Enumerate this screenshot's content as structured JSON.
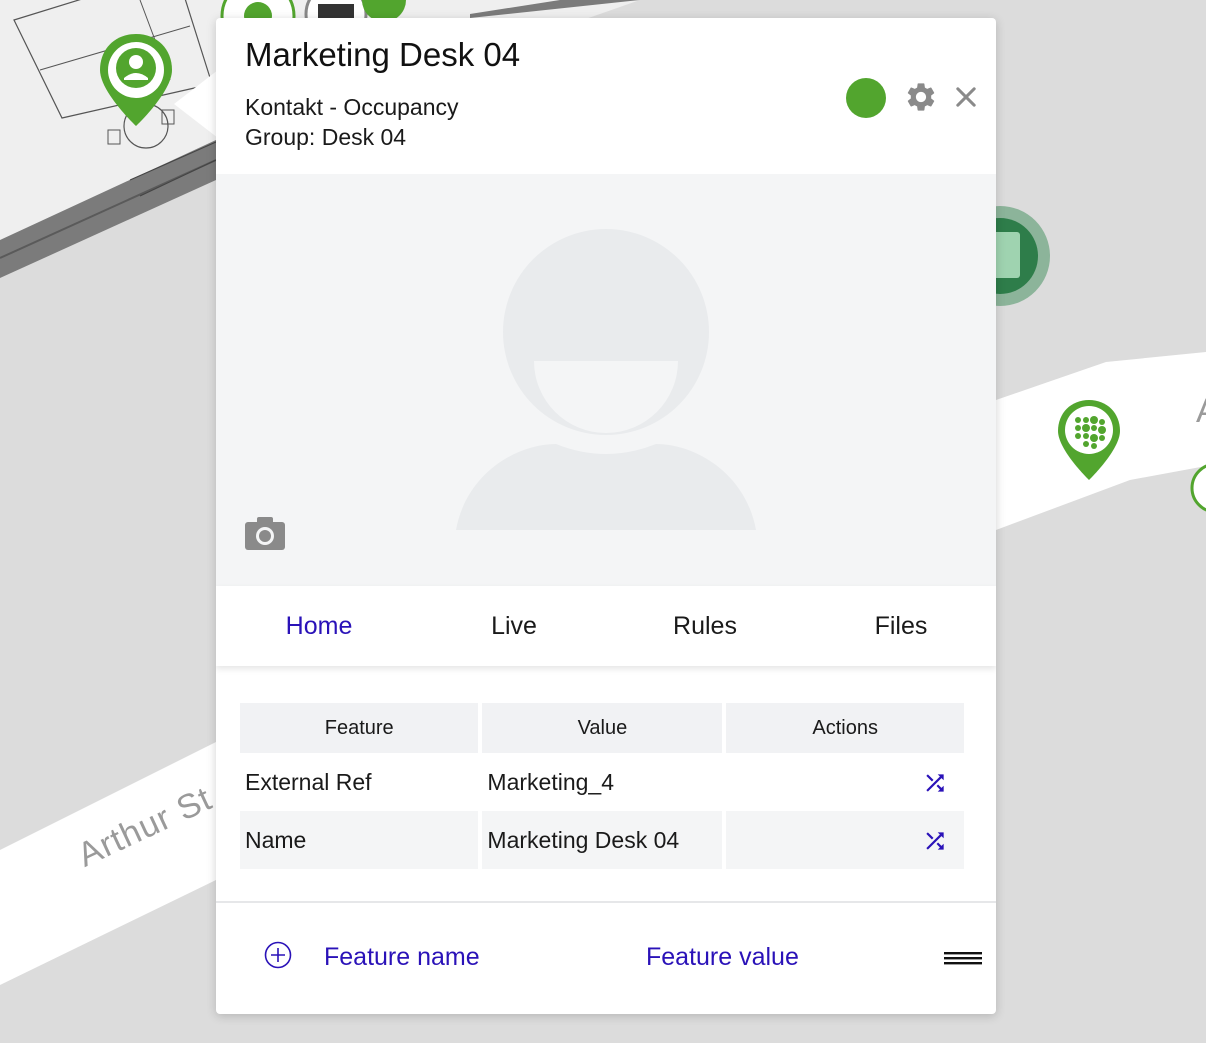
{
  "map": {
    "street_label": "Arthur St",
    "edge_label": "A"
  },
  "panel": {
    "title": "Marketing Desk 04",
    "subtitle": "Kontakt - Occupancy",
    "group": "Group: Desk 04",
    "status_color": "#52a52e",
    "icons": {
      "status": "status-dot",
      "settings": "gear-icon",
      "close": "close-icon",
      "photo": "avatar-placeholder",
      "camera": "camera-icon"
    }
  },
  "tabs": [
    {
      "label": "Home",
      "active": true
    },
    {
      "label": "Live",
      "active": false
    },
    {
      "label": "Rules",
      "active": false
    },
    {
      "label": "Files",
      "active": false
    }
  ],
  "table": {
    "headers": [
      "Feature",
      "Value",
      "Actions"
    ],
    "rows": [
      {
        "feature": "External Ref",
        "value": "Marketing_4",
        "action_icon": "shuffle-icon"
      },
      {
        "feature": "Name",
        "value": "Marketing Desk 04",
        "action_icon": "shuffle-icon"
      }
    ]
  },
  "footer": {
    "add_icon": "add-circle-icon",
    "feature_name_label": "Feature name",
    "feature_value_label": "Feature value",
    "menu_icon": "menu-icon"
  },
  "colors": {
    "accent": "#2a12b8",
    "marker_green": "#52a52e",
    "map_bg": "#dcdcdc"
  }
}
